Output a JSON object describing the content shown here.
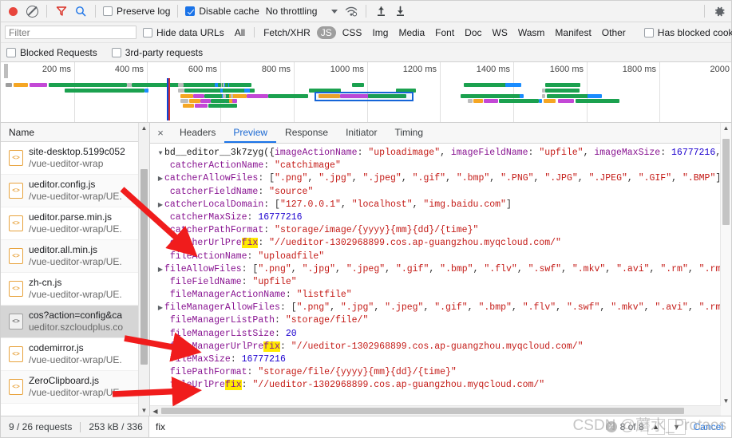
{
  "toolbar": {
    "record_tooltip": "Record network log",
    "clear_tooltip": "Clear",
    "filter_tooltip": "Filter",
    "search_tooltip": "Search",
    "preserve_log_label": "Preserve log",
    "preserve_log_checked": false,
    "disable_cache_label": "Disable cache",
    "disable_cache_checked": true,
    "throttling_value": "No throttling",
    "import_tooltip": "Import HAR file",
    "export_tooltip": "Export HAR",
    "settings_tooltip": "Network settings"
  },
  "filterbar": {
    "filter_placeholder": "Filter",
    "filter_value": "",
    "hide_data_urls_label": "Hide data URLs",
    "hide_data_urls_checked": false,
    "types": [
      {
        "label": "All",
        "active": false
      },
      {
        "label": "Fetch/XHR",
        "active": false
      },
      {
        "label": "JS",
        "active": true
      },
      {
        "label": "CSS",
        "active": false
      },
      {
        "label": "Img",
        "active": false
      },
      {
        "label": "Media",
        "active": false
      },
      {
        "label": "Font",
        "active": false
      },
      {
        "label": "Doc",
        "active": false
      },
      {
        "label": "WS",
        "active": false
      },
      {
        "label": "Wasm",
        "active": false
      },
      {
        "label": "Manifest",
        "active": false
      },
      {
        "label": "Other",
        "active": false
      }
    ],
    "has_blocked_cookies_label": "Has blocked cookies",
    "has_blocked_cookies_checked": false
  },
  "blockedbar": {
    "blocked_requests_label": "Blocked Requests",
    "blocked_requests_checked": false,
    "third_party_label": "3rd-party requests",
    "third_party_checked": false
  },
  "overview": {
    "ticks": [
      "200 ms",
      "400 ms",
      "600 ms",
      "800 ms",
      "1000 ms",
      "1200 ms",
      "1400 ms",
      "1600 ms",
      "1800 ms",
      "2000"
    ]
  },
  "requests": {
    "column_header": "Name",
    "rows": [
      {
        "name": "site-desktop.5199c052",
        "path": "/vue-ueditor-wrap",
        "icon": "js-file-icon",
        "selected": false
      },
      {
        "name": "ueditor.config.js",
        "path": "/vue-ueditor-wrap/UE.",
        "icon": "js-file-icon",
        "selected": false
      },
      {
        "name": "ueditor.parse.min.js",
        "path": "/vue-ueditor-wrap/UE.",
        "icon": "js-file-icon",
        "selected": false
      },
      {
        "name": "ueditor.all.min.js",
        "path": "/vue-ueditor-wrap/UE.",
        "icon": "js-file-icon",
        "selected": false
      },
      {
        "name": "zh-cn.js",
        "path": "/vue-ueditor-wrap/UE.",
        "icon": "js-file-icon",
        "selected": false
      },
      {
        "name": "cos?action=config&ca",
        "path": "ueditor.szcloudplus.co",
        "icon": "generic-file-icon",
        "selected": true
      },
      {
        "name": "codemirror.js",
        "path": "/vue-ueditor-wrap/UE.",
        "icon": "js-file-icon",
        "selected": false
      },
      {
        "name": "ZeroClipboard.js",
        "path": "/vue-ueditor-wrap/UE.",
        "icon": "js-file-icon",
        "selected": false
      }
    ]
  },
  "detail": {
    "close_label": "×",
    "tabs": [
      {
        "label": "Headers",
        "active": false
      },
      {
        "label": "Preview",
        "active": true
      },
      {
        "label": "Response",
        "active": false
      },
      {
        "label": "Initiator",
        "active": false
      },
      {
        "label": "Timing",
        "active": false
      }
    ],
    "preview_lines": [
      {
        "arrow": "down",
        "indent": 0,
        "segs": [
          {
            "t": "bd__editor__3k7zyg({",
            "c": "k-func"
          },
          {
            "t": "imageActionName",
            "c": "k-key"
          },
          {
            "t": ": ",
            "c": "k-punc"
          },
          {
            "t": "\"uploadimage\"",
            "c": "k-str"
          },
          {
            "t": ", ",
            "c": "k-punc"
          },
          {
            "t": "imageFieldName",
            "c": "k-key"
          },
          {
            "t": ": ",
            "c": "k-punc"
          },
          {
            "t": "\"upfile\"",
            "c": "k-str"
          },
          {
            "t": ", ",
            "c": "k-punc"
          },
          {
            "t": "imageMaxSize",
            "c": "k-key"
          },
          {
            "t": ": ",
            "c": "k-punc"
          },
          {
            "t": "16777216",
            "c": "k-num"
          },
          {
            "t": ",…})",
            "c": "k-punc"
          }
        ]
      },
      {
        "arrow": "none",
        "indent": 1,
        "segs": [
          {
            "t": "catcherActionName",
            "c": "k-key"
          },
          {
            "t": ": ",
            "c": "k-punc"
          },
          {
            "t": "\"catchimage\"",
            "c": "k-str"
          }
        ]
      },
      {
        "arrow": "right",
        "indent": 0,
        "segs": [
          {
            "t": "catcherAllowFiles",
            "c": "k-key"
          },
          {
            "t": ": [",
            "c": "k-punc"
          },
          {
            "t": "\".png\"",
            "c": "k-str"
          },
          {
            "t": ", ",
            "c": "k-punc"
          },
          {
            "t": "\".jpg\"",
            "c": "k-str"
          },
          {
            "t": ", ",
            "c": "k-punc"
          },
          {
            "t": "\".jpeg\"",
            "c": "k-str"
          },
          {
            "t": ", ",
            "c": "k-punc"
          },
          {
            "t": "\".gif\"",
            "c": "k-str"
          },
          {
            "t": ", ",
            "c": "k-punc"
          },
          {
            "t": "\".bmp\"",
            "c": "k-str"
          },
          {
            "t": ", ",
            "c": "k-punc"
          },
          {
            "t": "\".PNG\"",
            "c": "k-str"
          },
          {
            "t": ", ",
            "c": "k-punc"
          },
          {
            "t": "\".JPG\"",
            "c": "k-str"
          },
          {
            "t": ", ",
            "c": "k-punc"
          },
          {
            "t": "\".JPEG\"",
            "c": "k-str"
          },
          {
            "t": ", ",
            "c": "k-punc"
          },
          {
            "t": "\".GIF\"",
            "c": "k-str"
          },
          {
            "t": ", ",
            "c": "k-punc"
          },
          {
            "t": "\".BMP\"",
            "c": "k-str"
          },
          {
            "t": "]",
            "c": "k-punc"
          }
        ]
      },
      {
        "arrow": "none",
        "indent": 1,
        "segs": [
          {
            "t": "catcherFieldName",
            "c": "k-key"
          },
          {
            "t": ": ",
            "c": "k-punc"
          },
          {
            "t": "\"source\"",
            "c": "k-str"
          }
        ]
      },
      {
        "arrow": "right",
        "indent": 0,
        "segs": [
          {
            "t": "catcherLocalDomain",
            "c": "k-key"
          },
          {
            "t": ": [",
            "c": "k-punc"
          },
          {
            "t": "\"127.0.0.1\"",
            "c": "k-str"
          },
          {
            "t": ", ",
            "c": "k-punc"
          },
          {
            "t": "\"localhost\"",
            "c": "k-str"
          },
          {
            "t": ", ",
            "c": "k-punc"
          },
          {
            "t": "\"img.baidu.com\"",
            "c": "k-str"
          },
          {
            "t": "]",
            "c": "k-punc"
          }
        ]
      },
      {
        "arrow": "none",
        "indent": 1,
        "segs": [
          {
            "t": "catcherMaxSize",
            "c": "k-key"
          },
          {
            "t": ": ",
            "c": "k-punc"
          },
          {
            "t": "16777216",
            "c": "k-num"
          }
        ]
      },
      {
        "arrow": "none",
        "indent": 1,
        "segs": [
          {
            "t": "catcherPathFormat",
            "c": "k-key"
          },
          {
            "t": ": ",
            "c": "k-punc"
          },
          {
            "t": "\"storage/image/{yyyy}{mm}{dd}/{time}\"",
            "c": "k-str"
          }
        ]
      },
      {
        "arrow": "none",
        "indent": 1,
        "marked": true,
        "segs": [
          {
            "t": "catcherUrlPre",
            "c": "k-key"
          },
          {
            "t": "fix",
            "c": "k-key",
            "hl": true
          },
          {
            "t": ": ",
            "c": "k-punc"
          },
          {
            "t": "\"//ueditor-1302968899.cos.ap-guangzhou.myqcloud.com/\"",
            "c": "k-str"
          }
        ]
      },
      {
        "arrow": "none",
        "indent": 1,
        "segs": [
          {
            "t": "fileActionName",
            "c": "k-key"
          },
          {
            "t": ": ",
            "c": "k-punc"
          },
          {
            "t": "\"uploadfile\"",
            "c": "k-str"
          }
        ]
      },
      {
        "arrow": "right",
        "indent": 0,
        "segs": [
          {
            "t": "fileAllowFiles",
            "c": "k-key"
          },
          {
            "t": ": [",
            "c": "k-punc"
          },
          {
            "t": "\".png\"",
            "c": "k-str"
          },
          {
            "t": ", ",
            "c": "k-punc"
          },
          {
            "t": "\".jpg\"",
            "c": "k-str"
          },
          {
            "t": ", ",
            "c": "k-punc"
          },
          {
            "t": "\".jpeg\"",
            "c": "k-str"
          },
          {
            "t": ", ",
            "c": "k-punc"
          },
          {
            "t": "\".gif\"",
            "c": "k-str"
          },
          {
            "t": ", ",
            "c": "k-punc"
          },
          {
            "t": "\".bmp\"",
            "c": "k-str"
          },
          {
            "t": ", ",
            "c": "k-punc"
          },
          {
            "t": "\".flv\"",
            "c": "k-str"
          },
          {
            "t": ", ",
            "c": "k-punc"
          },
          {
            "t": "\".swf\"",
            "c": "k-str"
          },
          {
            "t": ", ",
            "c": "k-punc"
          },
          {
            "t": "\".mkv\"",
            "c": "k-str"
          },
          {
            "t": ", ",
            "c": "k-punc"
          },
          {
            "t": "\".avi\"",
            "c": "k-str"
          },
          {
            "t": ", ",
            "c": "k-punc"
          },
          {
            "t": "\".rm\"",
            "c": "k-str"
          },
          {
            "t": ", ",
            "c": "k-punc"
          },
          {
            "t": "\".rmvb\"",
            "c": "k-str"
          },
          {
            "t": ",",
            "c": "k-punc"
          }
        ]
      },
      {
        "arrow": "none",
        "indent": 1,
        "segs": [
          {
            "t": "fileFieldName",
            "c": "k-key"
          },
          {
            "t": ": ",
            "c": "k-punc"
          },
          {
            "t": "\"upfile\"",
            "c": "k-str"
          }
        ]
      },
      {
        "arrow": "none",
        "indent": 1,
        "segs": [
          {
            "t": "fileManagerActionName",
            "c": "k-key"
          },
          {
            "t": ": ",
            "c": "k-punc"
          },
          {
            "t": "\"listfile\"",
            "c": "k-str"
          }
        ]
      },
      {
        "arrow": "right",
        "indent": 0,
        "segs": [
          {
            "t": "fileManagerAllowFiles",
            "c": "k-key"
          },
          {
            "t": ": [",
            "c": "k-punc"
          },
          {
            "t": "\".png\"",
            "c": "k-str"
          },
          {
            "t": ", ",
            "c": "k-punc"
          },
          {
            "t": "\".jpg\"",
            "c": "k-str"
          },
          {
            "t": ", ",
            "c": "k-punc"
          },
          {
            "t": "\".jpeg\"",
            "c": "k-str"
          },
          {
            "t": ", ",
            "c": "k-punc"
          },
          {
            "t": "\".gif\"",
            "c": "k-str"
          },
          {
            "t": ", ",
            "c": "k-punc"
          },
          {
            "t": "\".bmp\"",
            "c": "k-str"
          },
          {
            "t": ", ",
            "c": "k-punc"
          },
          {
            "t": "\".flv\"",
            "c": "k-str"
          },
          {
            "t": ", ",
            "c": "k-punc"
          },
          {
            "t": "\".swf\"",
            "c": "k-str"
          },
          {
            "t": ", ",
            "c": "k-punc"
          },
          {
            "t": "\".mkv\"",
            "c": "k-str"
          },
          {
            "t": ", ",
            "c": "k-punc"
          },
          {
            "t": "\".avi\"",
            "c": "k-str"
          },
          {
            "t": ", ",
            "c": "k-punc"
          },
          {
            "t": "\".rm\"",
            "c": "k-str"
          },
          {
            "t": ", ",
            "c": "k-punc"
          },
          {
            "t": "\".",
            "c": "k-str"
          }
        ]
      },
      {
        "arrow": "none",
        "indent": 1,
        "segs": [
          {
            "t": "fileManagerListPath",
            "c": "k-key"
          },
          {
            "t": ": ",
            "c": "k-punc"
          },
          {
            "t": "\"storage/file/\"",
            "c": "k-str"
          }
        ]
      },
      {
        "arrow": "none",
        "indent": 1,
        "segs": [
          {
            "t": "fileManagerListSize",
            "c": "k-key"
          },
          {
            "t": ": ",
            "c": "k-punc"
          },
          {
            "t": "20",
            "c": "k-num"
          }
        ]
      },
      {
        "arrow": "none",
        "indent": 1,
        "marked": true,
        "segs": [
          {
            "t": "fileManagerUrlPre",
            "c": "k-key"
          },
          {
            "t": "fix",
            "c": "k-key",
            "hl": true
          },
          {
            "t": ": ",
            "c": "k-punc"
          },
          {
            "t": "\"//ueditor-1302968899.cos.ap-guangzhou.myqcloud.com/\"",
            "c": "k-str"
          }
        ]
      },
      {
        "arrow": "none",
        "indent": 1,
        "segs": [
          {
            "t": "fileMaxSize",
            "c": "k-key"
          },
          {
            "t": ": ",
            "c": "k-punc"
          },
          {
            "t": "16777216",
            "c": "k-num"
          }
        ]
      },
      {
        "arrow": "none",
        "indent": 1,
        "segs": [
          {
            "t": "filePathFormat",
            "c": "k-key"
          },
          {
            "t": ": ",
            "c": "k-punc"
          },
          {
            "t": "\"storage/file/{yyyy}{mm}{dd}/{time}\"",
            "c": "k-str"
          }
        ]
      },
      {
        "arrow": "none",
        "indent": 1,
        "marked": true,
        "segs": [
          {
            "t": "fileUrlPre",
            "c": "k-key"
          },
          {
            "t": "fix",
            "c": "k-key",
            "hl": true
          },
          {
            "t": ": ",
            "c": "k-punc"
          },
          {
            "t": "\"//ueditor-1302968899.cos.ap-guangzhou.myqcloud.com/\"",
            "c": "k-str"
          }
        ]
      }
    ]
  },
  "status": {
    "requests_text": "9 / 26 requests",
    "transfer_text": "253 kB / 336"
  },
  "find": {
    "value": "fix",
    "count_text": "8 of 8",
    "prev_label": "▲",
    "next_label": "▼",
    "cancel_label": "Cancel"
  },
  "watermark": {
    "text": "CSDN @蘑水_Protaos"
  },
  "colors": {
    "accent": "#1a73e8",
    "record": "#e8453c",
    "highlight": "#ffea00",
    "arrow": "#f01c1c",
    "selected_row": "#d5d5d5"
  }
}
